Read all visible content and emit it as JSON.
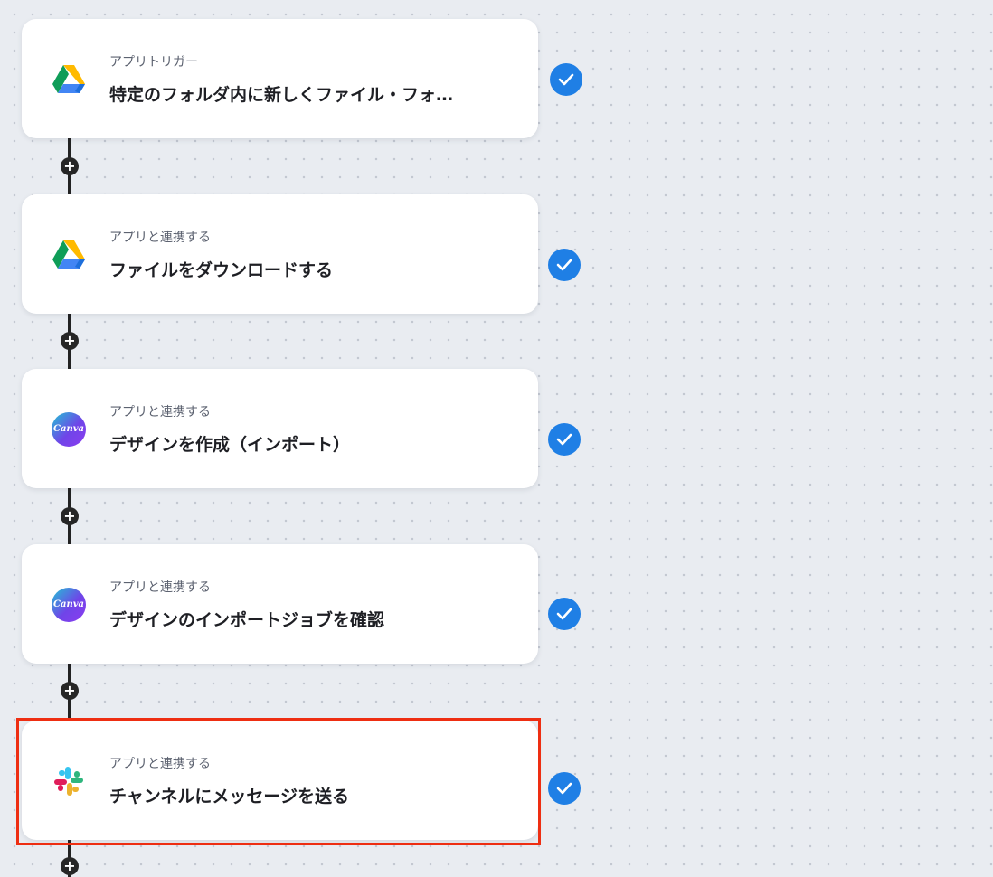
{
  "steps": [
    {
      "subtitle": "アプリトリガー",
      "title": "特定のフォルダ内に新しくファイル・フォ…",
      "icon": "google-drive-icon",
      "completed": true
    },
    {
      "subtitle": "アプリと連携する",
      "title": "ファイルをダウンロードする",
      "icon": "google-drive-icon",
      "completed": true
    },
    {
      "subtitle": "アプリと連携する",
      "title": "デザインを作成（インポート）",
      "icon": "canva-icon",
      "icon_text": "Canva",
      "completed": true
    },
    {
      "subtitle": "アプリと連携する",
      "title": "デザインのインポートジョブを確認",
      "icon": "canva-icon",
      "icon_text": "Canva",
      "completed": true
    },
    {
      "subtitle": "アプリと連携する",
      "title": "チャンネルにメッセージを送る",
      "icon": "slack-icon",
      "completed": true,
      "highlighted": true
    }
  ],
  "add_step_label": "+",
  "colors": {
    "check_blue": "#1f7fe5",
    "highlight_red": "#ee2e12",
    "connector": "#222222"
  }
}
